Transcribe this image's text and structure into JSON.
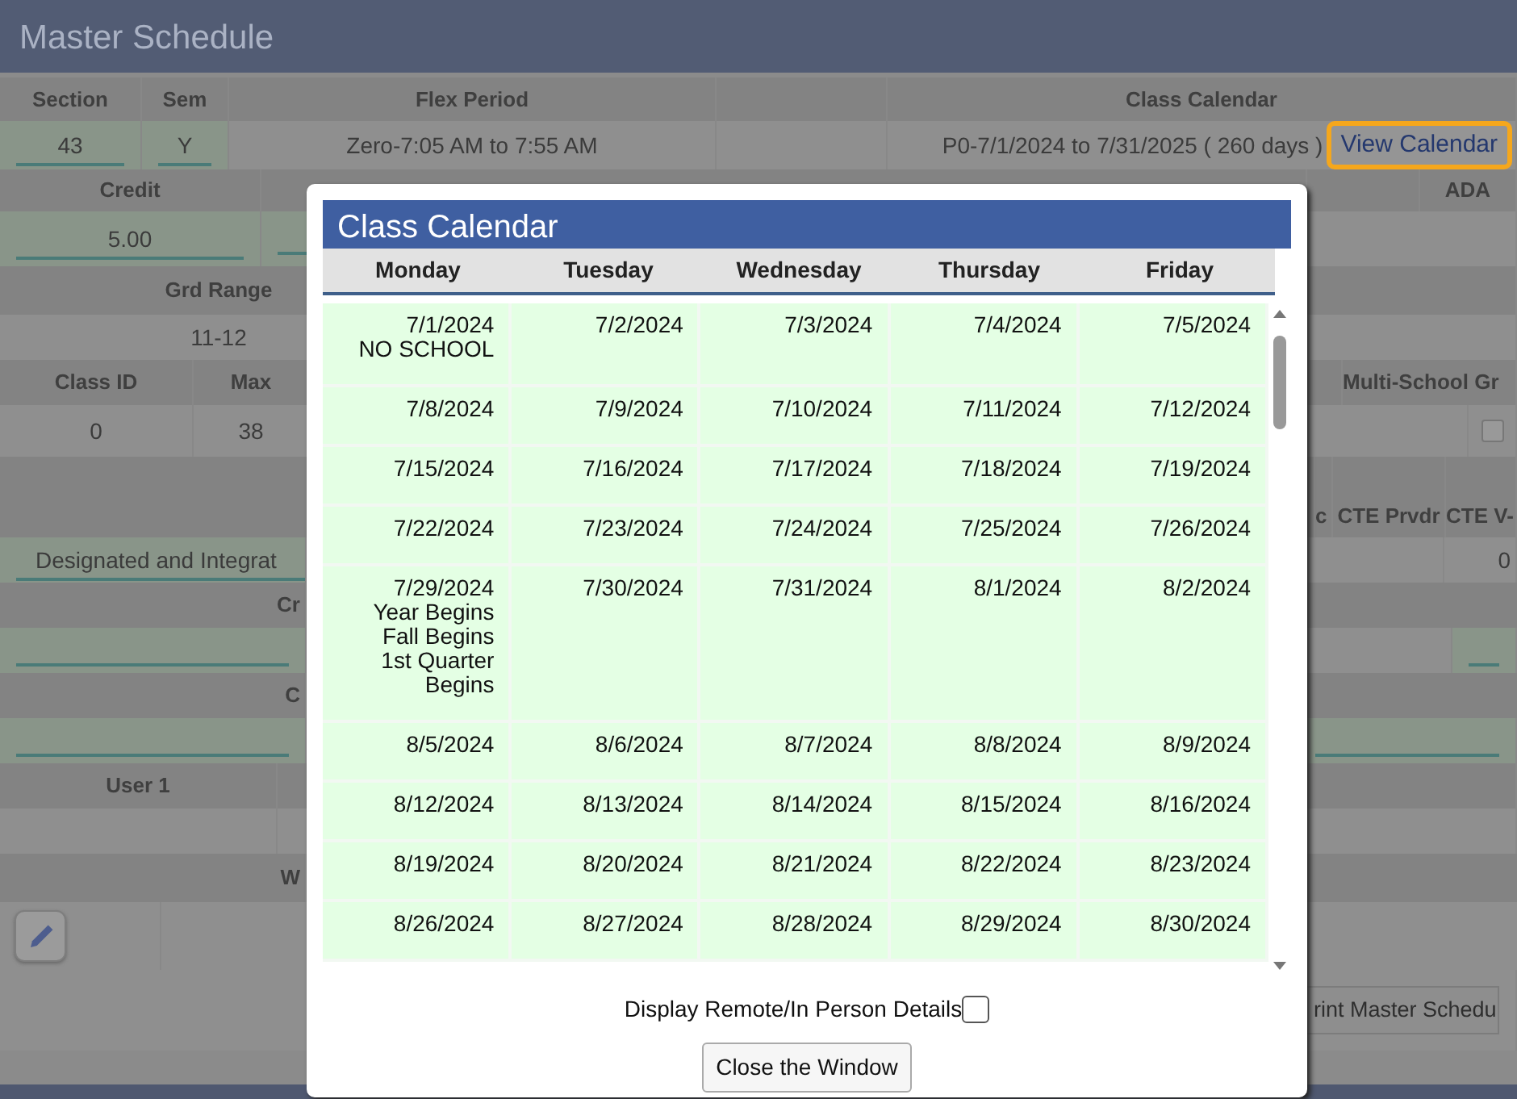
{
  "window": {
    "title": "Master Schedule"
  },
  "form": {
    "rows": [
      {
        "kind": "header",
        "cells": [
          {
            "kind": "label",
            "text": "Section"
          },
          {
            "kind": "label",
            "text": "Sem"
          },
          {
            "kind": "label",
            "text": "Flex Period"
          },
          {
            "kind": "blank"
          },
          {
            "kind": "label",
            "text": "Class Calendar"
          }
        ]
      },
      {
        "kind": "value",
        "cells": [
          {
            "kind": "field",
            "text": "43"
          },
          {
            "kind": "field",
            "text": "Y"
          },
          {
            "kind": "text",
            "text": "Zero-7:05 AM to 7:55 AM"
          },
          {
            "kind": "text",
            "text": ""
          },
          {
            "kind": "calendar",
            "text": "P0-7/1/2024 to 7/31/2025 ( 260 days )",
            "link": "View Calendar",
            "focused": true
          }
        ]
      },
      {
        "kind": "header",
        "cells": [
          {
            "kind": "label",
            "text": "Credit"
          },
          {
            "kind": "blank"
          },
          {
            "kind": "blank"
          },
          {
            "kind": "label",
            "text": "ADA"
          }
        ]
      },
      {
        "kind": "value",
        "cells": [
          {
            "kind": "field",
            "text": "5.00"
          },
          {
            "kind": "field",
            "text": ""
          },
          {
            "kind": "blank"
          }
        ]
      },
      {
        "kind": "header",
        "cells": [
          {
            "kind": "label",
            "text": "Grd Range"
          },
          {
            "kind": "blank"
          }
        ]
      },
      {
        "kind": "value",
        "cells": [
          {
            "kind": "text",
            "text": "11-12"
          },
          {
            "kind": "blank"
          }
        ]
      },
      {
        "kind": "header",
        "cells": [
          {
            "kind": "label",
            "text": "Class ID"
          },
          {
            "kind": "label",
            "text": "Max"
          },
          {
            "kind": "blank"
          },
          {
            "kind": "label",
            "text": "Multi-School Gr"
          }
        ]
      },
      {
        "kind": "value",
        "cells": [
          {
            "kind": "text",
            "text": "0"
          },
          {
            "kind": "text",
            "text": "38"
          },
          {
            "kind": "blank"
          },
          {
            "kind": "checkbox",
            "checked": false
          }
        ]
      },
      {
        "kind": "header",
        "cells": [
          {
            "kind": "blank"
          },
          {
            "kind": "label",
            "text": "c"
          },
          {
            "kind": "label",
            "text": "CTE Prvdr"
          },
          {
            "kind": "label",
            "text": "CTE V-"
          }
        ]
      },
      {
        "kind": "value",
        "cells": [
          {
            "kind": "field",
            "text": "Designated and Integrat"
          },
          {
            "kind": "blank"
          },
          {
            "kind": "text",
            "text": "0"
          }
        ]
      },
      {
        "kind": "header",
        "cells": [
          {
            "kind": "label",
            "text": "Cr"
          }
        ]
      },
      {
        "kind": "value",
        "cells": [
          {
            "kind": "field",
            "text": ""
          },
          {
            "kind": "blank"
          },
          {
            "kind": "field",
            "text": ""
          }
        ]
      },
      {
        "kind": "header",
        "cells": [
          {
            "kind": "label",
            "text": "C"
          }
        ]
      },
      {
        "kind": "value",
        "cells": [
          {
            "kind": "field",
            "text": ""
          },
          {
            "kind": "blank"
          },
          {
            "kind": "field",
            "text": ""
          }
        ]
      },
      {
        "kind": "header",
        "cells": [
          {
            "kind": "label",
            "text": "User 1"
          },
          {
            "kind": "blank"
          }
        ]
      },
      {
        "kind": "value",
        "cells": [
          {
            "kind": "blank"
          },
          {
            "kind": "blank"
          }
        ]
      },
      {
        "kind": "header",
        "cells": [
          {
            "kind": "label",
            "text": "W"
          }
        ]
      },
      {
        "kind": "value",
        "cells": [
          {
            "kind": "edit"
          }
        ]
      },
      {
        "kind": "value",
        "cells": [
          {
            "kind": "blank"
          },
          {
            "kind": "button",
            "text": "rint Master Schedu"
          }
        ]
      }
    ]
  },
  "modal": {
    "title": "Class Calendar",
    "days": [
      "Monday",
      "Tuesday",
      "Wednesday",
      "Thursday",
      "Friday"
    ],
    "weeks": [
      {
        "dates": [
          {
            "date": "7/1/2024",
            "notes": [
              "NO SCHOOL"
            ]
          },
          {
            "date": "7/2/2024"
          },
          {
            "date": "7/3/2024"
          },
          {
            "date": "7/4/2024"
          },
          {
            "date": "7/5/2024"
          }
        ]
      },
      {
        "dates": [
          {
            "date": "7/8/2024"
          },
          {
            "date": "7/9/2024"
          },
          {
            "date": "7/10/2024"
          },
          {
            "date": "7/11/2024"
          },
          {
            "date": "7/12/2024"
          }
        ]
      },
      {
        "dates": [
          {
            "date": "7/15/2024"
          },
          {
            "date": "7/16/2024"
          },
          {
            "date": "7/17/2024"
          },
          {
            "date": "7/18/2024"
          },
          {
            "date": "7/19/2024"
          }
        ]
      },
      {
        "dates": [
          {
            "date": "7/22/2024"
          },
          {
            "date": "7/23/2024"
          },
          {
            "date": "7/24/2024"
          },
          {
            "date": "7/25/2024"
          },
          {
            "date": "7/26/2024"
          }
        ]
      },
      {
        "dates": [
          {
            "date": "7/29/2024",
            "notes": [
              "Year Begins",
              "Fall Begins",
              "1st Quarter Begins"
            ]
          },
          {
            "date": "7/30/2024"
          },
          {
            "date": "7/31/2024"
          },
          {
            "date": "8/1/2024"
          },
          {
            "date": "8/2/2024"
          }
        ]
      },
      {
        "dates": [
          {
            "date": "8/5/2024"
          },
          {
            "date": "8/6/2024"
          },
          {
            "date": "8/7/2024"
          },
          {
            "date": "8/8/2024"
          },
          {
            "date": "8/9/2024"
          }
        ]
      },
      {
        "dates": [
          {
            "date": "8/12/2024"
          },
          {
            "date": "8/13/2024"
          },
          {
            "date": "8/14/2024"
          },
          {
            "date": "8/15/2024"
          },
          {
            "date": "8/16/2024"
          }
        ]
      },
      {
        "dates": [
          {
            "date": "8/19/2024"
          },
          {
            "date": "8/20/2024"
          },
          {
            "date": "8/21/2024"
          },
          {
            "date": "8/22/2024"
          },
          {
            "date": "8/23/2024"
          }
        ]
      },
      {
        "dates": [
          {
            "date": "8/26/2024"
          },
          {
            "date": "8/27/2024"
          },
          {
            "date": "8/28/2024"
          },
          {
            "date": "8/29/2024"
          },
          {
            "date": "8/30/2024"
          }
        ]
      }
    ],
    "option": {
      "label": "Display Remote/In Person Details",
      "checked": false
    },
    "close_button": "Close the Window"
  }
}
